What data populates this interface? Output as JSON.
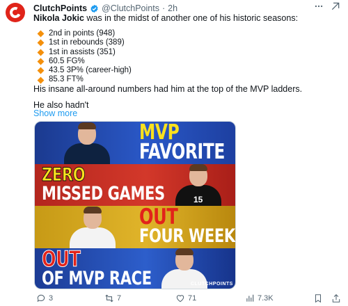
{
  "author": {
    "name": "ClutchPoints",
    "handle": "@ClutchPoints",
    "separator": "·",
    "time": "2h",
    "avatar_color": "#e0241a",
    "verified_color": "#1d9bf0"
  },
  "tweet": {
    "lead_bold": "Nikola Jokic",
    "lead_rest": " was in the midst of another one of his historic seasons:",
    "stats": [
      "2nd in points (948)",
      "1st in rebounds (389)",
      "1st in assists (351)",
      "60.5 FG%",
      "43.5 3P% (career-high)",
      "85.3 FT%"
    ],
    "bullet_icon": "orange-diamond-icon",
    "paragraph2": "His insane all-around numbers had him at the top of the MVP ladders.",
    "paragraph3": "He also hadn't",
    "show_more": "Show more"
  },
  "media": {
    "panels": [
      {
        "line1": "MVP",
        "line2": "FAVORITE"
      },
      {
        "line1": "ZERO",
        "line2": "MISSED GAMES",
        "jersey_number": "15"
      },
      {
        "line1": "OUT",
        "line2": "FOUR WEEKS"
      },
      {
        "line1": "OUT",
        "line2": "OF MVP RACE"
      }
    ],
    "watermark": "CLUTCHPOINTS"
  },
  "actions": {
    "replies": "3",
    "reposts": "7",
    "likes": "71",
    "views": "7.3K"
  }
}
